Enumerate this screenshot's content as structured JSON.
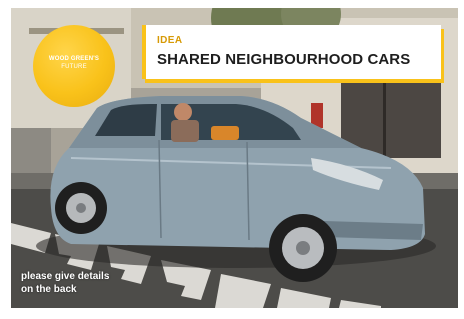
{
  "badge": {
    "title": "WOOD GREEN'S",
    "subtitle": "FUTURE"
  },
  "header": {
    "label": "IDEA",
    "title": "SHARED NEIGHBOURHOOD CARS"
  },
  "footer": {
    "line1": "please give details",
    "line2": "on the back"
  },
  "colors": {
    "accent": "#f9c21a",
    "label": "#d79a06",
    "car_body": "#8fa2ae"
  }
}
